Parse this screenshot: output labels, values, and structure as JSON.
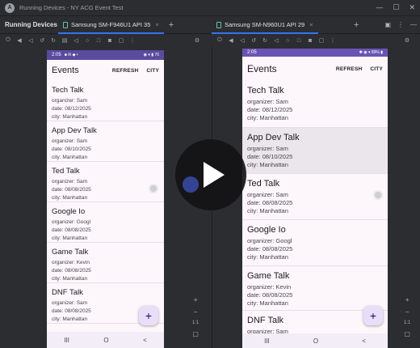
{
  "window": {
    "title": "Running Devices - NY ACG Event Test"
  },
  "tabs": {
    "panel_title": "Running Devices",
    "items": [
      {
        "label": "Samsung SM-F946U1 API 35",
        "close": "×"
      },
      {
        "label": "Samsung SM-N960U1 API 29",
        "close": "×"
      }
    ],
    "add": "+"
  },
  "left_device": {
    "status_time": "2:05",
    "status_icons": "■ ✉ ◆ •",
    "status_right": "◉ ▾ ▮ 76",
    "app_title": "Events",
    "actions": [
      "REFRESH",
      "CITY"
    ],
    "events": [
      {
        "name": "Tech Talk",
        "organizer": "organizer: Sam",
        "date": "date: 08/12/2025",
        "city": "city: Manhattan"
      },
      {
        "name": "App Dev Talk",
        "organizer": "organizer: Sam",
        "date": "date: 08/10/2025",
        "city": "city: Manhattan"
      },
      {
        "name": "Ted Talk",
        "organizer": "organizer: Sam",
        "date": "date: 08/08/2025",
        "city": "city: Manhattan"
      },
      {
        "name": "Google Io",
        "organizer": "organizer: Googl",
        "date": "date: 08/08/2025",
        "city": "city: Manhattan"
      },
      {
        "name": "Game Talk",
        "organizer": "organizer: Kevin",
        "date": "date: 08/08/2025",
        "city": "city: Manhattan"
      },
      {
        "name": "DNF Talk",
        "organizer": "organizer: Sam",
        "date": "date: 08/08/2025",
        "city": "city: Manhattan"
      }
    ],
    "fab": "+",
    "nav": [
      "III",
      "O",
      "<"
    ]
  },
  "right_device": {
    "status_time": "2:05",
    "status_right": "✱ ◉ ▾ 89% ▮",
    "app_title": "Events",
    "actions": [
      "REFRESH",
      "CITY"
    ],
    "events": [
      {
        "name": "Tech Talk",
        "organizer": "organizer: Sam",
        "date": "date: 08/12/2025",
        "city": "city: Manhattan"
      },
      {
        "name": "App Dev Talk",
        "organizer": "organizer: Sam",
        "date": "date: 08/10/2025",
        "city": "city: Manhattan"
      },
      {
        "name": "Ted Talk",
        "organizer": "organizer: Sam",
        "date": "date: 08/08/2025",
        "city": "city: Manhattan"
      },
      {
        "name": "Google Io",
        "organizer": "organizer: Googl",
        "date": "date: 08/08/2025",
        "city": "city: Manhattan"
      },
      {
        "name": "Game Talk",
        "organizer": "organizer: Kevin",
        "date": "date: 08/08/2025",
        "city": "city: Manhattan"
      },
      {
        "name": "DNF Talk",
        "organizer": "organizer: Sam",
        "date": "",
        "city": ""
      }
    ],
    "fab": "+",
    "nav": [
      "III",
      "O",
      "<"
    ]
  },
  "zoom": {
    "in": "+",
    "out": "−",
    "reset": "1:1"
  },
  "colors": {
    "left_statusbar": "#5b4a9e",
    "right_statusbar": "#6a54b3",
    "highlight": "#ebe5ec",
    "accent_tab": "#3574f0"
  }
}
